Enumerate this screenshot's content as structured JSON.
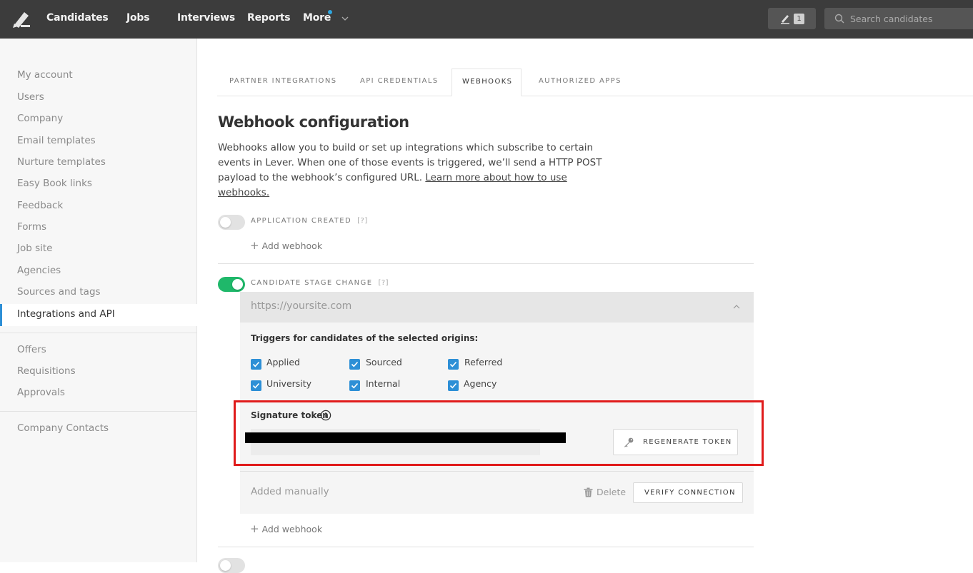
{
  "topbar": {
    "nav": [
      "Candidates",
      "Jobs",
      "Interviews",
      "Reports",
      "More"
    ],
    "notif_count": "1",
    "search_placeholder": "Search candidates"
  },
  "sidebar": {
    "group1": [
      "My account",
      "Users",
      "Company",
      "Email templates",
      "Nurture templates",
      "Easy Book links",
      "Feedback",
      "Forms",
      "Job site",
      "Agencies",
      "Sources and tags",
      "Integrations and API"
    ],
    "group2": [
      "Offers",
      "Requisitions",
      "Approvals"
    ],
    "group3": [
      "Company Contacts"
    ],
    "active": "Integrations and API",
    "accent": "#2d8fd6"
  },
  "tabs": [
    "PARTNER INTEGRATIONS",
    "API CREDENTIALS",
    "WEBHOOKS",
    "AUTHORIZED APPS"
  ],
  "active_tab": "WEBHOOKS",
  "main": {
    "title": "Webhook configuration",
    "desc_before": "Webhooks allow you to build or set up integrations which subscribe to certain events in Lever. When one of those events is triggered, we’ll send a HTTP POST payload to the webhook’s configured URL. ",
    "desc_link": "Learn more about how to use webhooks.",
    "help": "[?]",
    "add_webhook": "Add webhook"
  },
  "events": [
    {
      "label": "APPLICATION CREATED",
      "enabled": false
    },
    {
      "label": "CANDIDATE STAGE CHANGE",
      "enabled": true
    }
  ],
  "webhook": {
    "url_placeholder": "https://yoursite.com",
    "triggers_title": "Triggers for candidates of the selected origins:",
    "origins": [
      {
        "label": "Applied",
        "checked": true
      },
      {
        "label": "Sourced",
        "checked": true
      },
      {
        "label": "Referred",
        "checked": true
      },
      {
        "label": "University",
        "checked": true
      },
      {
        "label": "Internal",
        "checked": true
      },
      {
        "label": "Agency",
        "checked": true
      }
    ],
    "signature_title": "Signature token",
    "regenerate_label": "REGENERATE TOKEN",
    "added_text": "Added manually",
    "delete_label": "Delete",
    "verify_label": "VERIFY CONNECTION"
  },
  "colors": {
    "toggle_on": "#1fb86a",
    "highlight": "#e01b1b",
    "checkbox": "#2d8fd6"
  }
}
